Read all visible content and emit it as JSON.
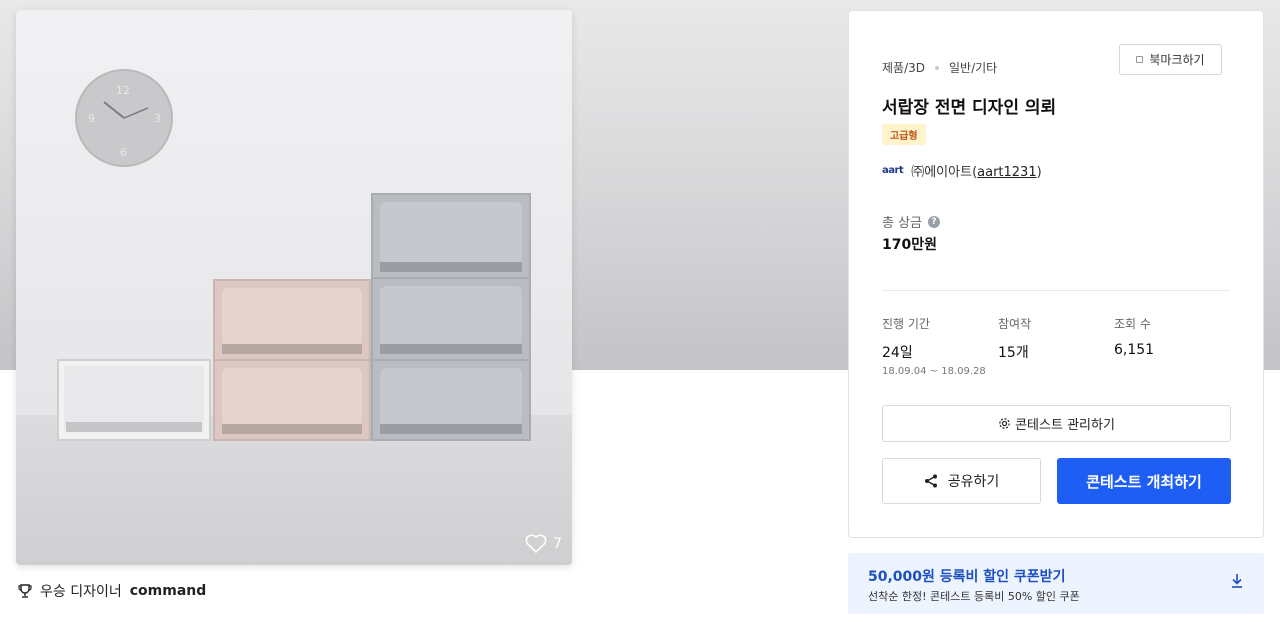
{
  "gallery": {
    "like_count": "7",
    "award_prefix": "우승 디자이너",
    "award_name": "command"
  },
  "panel": {
    "category_primary": "제품/3D",
    "category_secondary": "일반/기타",
    "bookmark_label": "북마크하기",
    "title": "서랍장 전면 디자인 의뢰",
    "tier_badge": "고급형",
    "host_logo": "aart",
    "host_name": "㈜에이아트",
    "host_id": "aart1231",
    "prize_label": "총 상금",
    "prize_value": "170만원",
    "stats": {
      "period_label": "진행 기간",
      "period_value": "24일",
      "period_dates": "18.09.04 ~ 18.09.28",
      "entries_label": "참여작",
      "entries_value": "15개",
      "views_label": "조회 수",
      "views_value": "6,151"
    },
    "manage_label": "콘테스트 관리하기",
    "share_label": "공유하기",
    "host_contest_label": "콘테스트 개최하기"
  },
  "coupon": {
    "title": "50,000원 등록비 할인 쿠폰받기",
    "subtitle": "선착순 한정! 콘테스트 등록비 50% 할인 쿠폰"
  },
  "colors": {
    "primary": "#1f5ef5",
    "badge_bg": "#fff3cc",
    "badge_text": "#c0581a",
    "coupon_bg": "#eef4ff",
    "coupon_text": "#1c4fbf"
  }
}
